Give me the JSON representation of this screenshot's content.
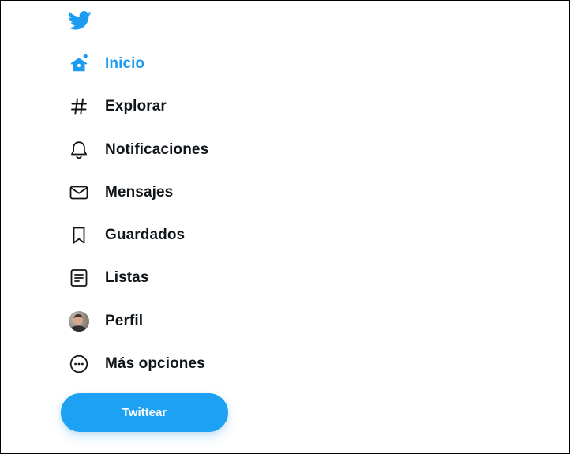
{
  "brand": {
    "logo_icon": "twitter-bird-icon",
    "accent_color": "#1d9bf0",
    "button_color": "#1da1f2",
    "text_color": "#0f1419"
  },
  "nav": {
    "items": [
      {
        "label": "Inicio",
        "icon": "home-icon",
        "active": true
      },
      {
        "label": "Explorar",
        "icon": "hashtag-icon",
        "active": false
      },
      {
        "label": "Notificaciones",
        "icon": "bell-icon",
        "active": false
      },
      {
        "label": "Mensajes",
        "icon": "envelope-icon",
        "active": false
      },
      {
        "label": "Guardados",
        "icon": "bookmark-icon",
        "active": false
      },
      {
        "label": "Listas",
        "icon": "list-icon",
        "active": false
      },
      {
        "label": "Perfil",
        "icon": "avatar",
        "active": false
      },
      {
        "label": "Más opciones",
        "icon": "more-options-icon",
        "active": false
      }
    ]
  },
  "tweet_button": {
    "label": "Twittear"
  }
}
